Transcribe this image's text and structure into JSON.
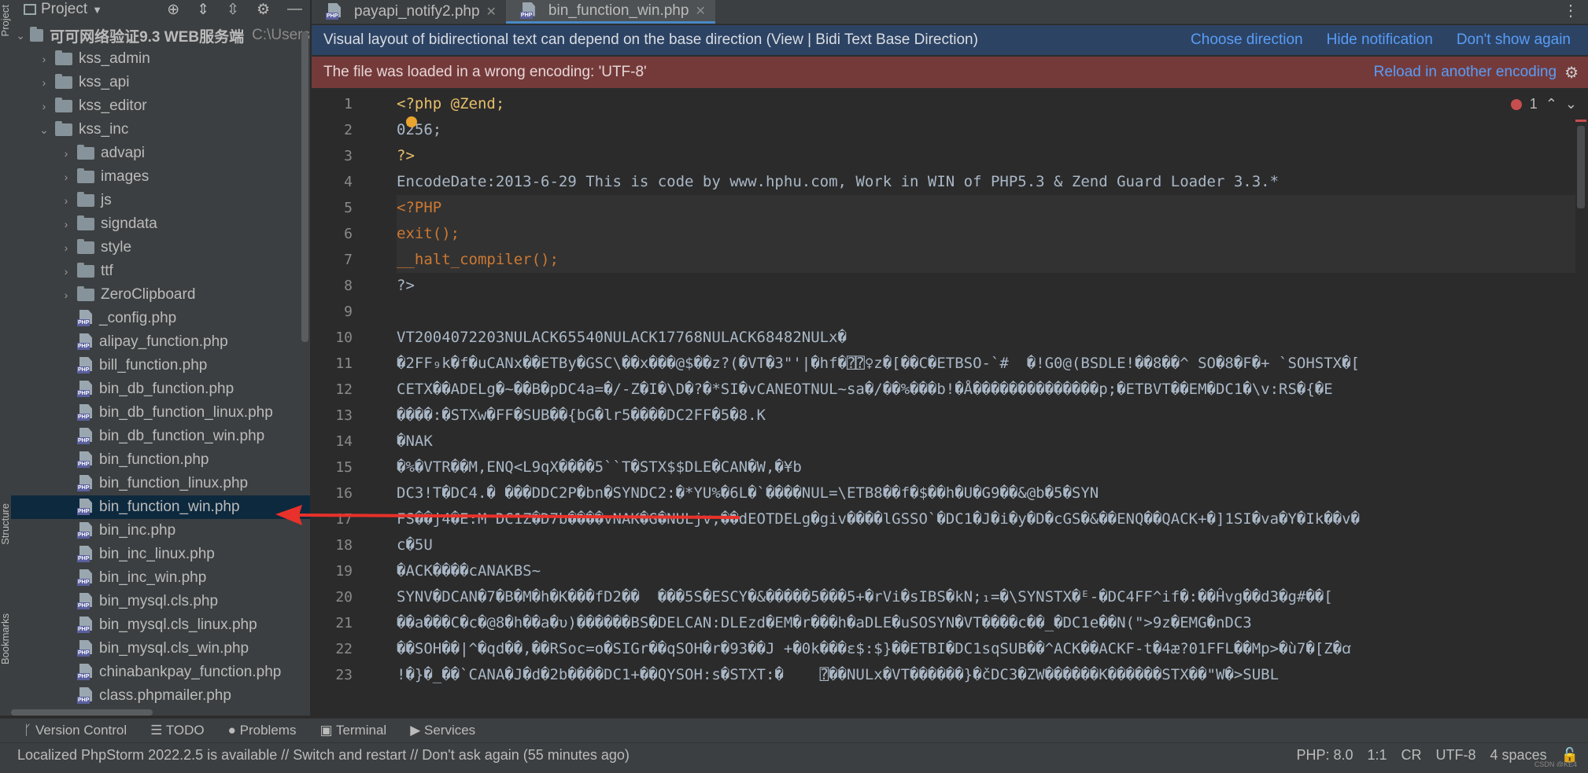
{
  "left_strip": {
    "tabs": [
      "Project",
      "Structure",
      "Bookmarks"
    ]
  },
  "project_panel": {
    "title": "Project",
    "root": {
      "name": "可可网络验证9.3 WEB服务端",
      "path": "C:\\Users"
    },
    "items": [
      {
        "label": "kss_admin",
        "type": "folder",
        "expanded": false,
        "indent": 1
      },
      {
        "label": "kss_api",
        "type": "folder",
        "expanded": false,
        "indent": 1
      },
      {
        "label": "kss_editor",
        "type": "folder",
        "expanded": false,
        "indent": 1
      },
      {
        "label": "kss_inc",
        "type": "folder",
        "expanded": true,
        "indent": 1
      },
      {
        "label": "advapi",
        "type": "folder",
        "expanded": false,
        "indent": 2
      },
      {
        "label": "images",
        "type": "folder",
        "expanded": false,
        "indent": 2
      },
      {
        "label": "js",
        "type": "folder",
        "expanded": false,
        "indent": 2
      },
      {
        "label": "signdata",
        "type": "folder",
        "expanded": false,
        "indent": 2
      },
      {
        "label": "style",
        "type": "folder",
        "expanded": false,
        "indent": 2
      },
      {
        "label": "ttf",
        "type": "folder",
        "expanded": false,
        "indent": 2
      },
      {
        "label": "ZeroClipboard",
        "type": "folder",
        "expanded": false,
        "indent": 2
      },
      {
        "label": "_config.php",
        "type": "php",
        "indent": 2
      },
      {
        "label": "alipay_function.php",
        "type": "php",
        "indent": 2
      },
      {
        "label": "bill_function.php",
        "type": "php",
        "indent": 2
      },
      {
        "label": "bin_db_function.php",
        "type": "php",
        "indent": 2
      },
      {
        "label": "bin_db_function_linux.php",
        "type": "php",
        "indent": 2
      },
      {
        "label": "bin_db_function_win.php",
        "type": "php",
        "indent": 2
      },
      {
        "label": "bin_function.php",
        "type": "php",
        "indent": 2
      },
      {
        "label": "bin_function_linux.php",
        "type": "php",
        "indent": 2
      },
      {
        "label": "bin_function_win.php",
        "type": "php",
        "indent": 2,
        "selected": true
      },
      {
        "label": "bin_inc.php",
        "type": "php",
        "indent": 2
      },
      {
        "label": "bin_inc_linux.php",
        "type": "php",
        "indent": 2
      },
      {
        "label": "bin_inc_win.php",
        "type": "php",
        "indent": 2
      },
      {
        "label": "bin_mysql.cls.php",
        "type": "php",
        "indent": 2
      },
      {
        "label": "bin_mysql.cls_linux.php",
        "type": "php",
        "indent": 2
      },
      {
        "label": "bin_mysql.cls_win.php",
        "type": "php",
        "indent": 2
      },
      {
        "label": "chinabankpay_function.php",
        "type": "php",
        "indent": 2
      },
      {
        "label": "class.phpmailer.php",
        "type": "php",
        "indent": 2
      }
    ]
  },
  "tabs": [
    {
      "label": "payapi_notify2.php",
      "active": false
    },
    {
      "label": "bin_function_win.php",
      "active": true
    }
  ],
  "bidi_notification": {
    "text": "Visual layout of bidirectional text can depend on the base direction (View | Bidi Text Base Direction)",
    "links": [
      "Choose direction",
      "Hide notification",
      "Don't show again"
    ]
  },
  "encoding_notification": {
    "text": "The file was loaded in a wrong encoding: 'UTF-8'",
    "link": "Reload in another encoding"
  },
  "inspection": {
    "errors": "1"
  },
  "code_lines": [
    {
      "n": "1",
      "text": "<?php @Zend;"
    },
    {
      "n": "2",
      "text": "0256;"
    },
    {
      "n": "3",
      "text": "?>"
    },
    {
      "n": "4",
      "text": "EncodeDate:2013-6-29 This is code by www.hphu.com, Work in WIN of PHP5.3 & Zend Guard Loader 3.3.*"
    },
    {
      "n": "5",
      "text": "<?PHP"
    },
    {
      "n": "6",
      "text": "exit();"
    },
    {
      "n": "7",
      "text": "__halt_compiler();"
    },
    {
      "n": "8",
      "text": "?>"
    },
    {
      "n": "9",
      "text": ""
    },
    {
      "n": "10",
      "text": "VT2004072203NULACK65540NULACK17768NULACK68482NULx�"
    },
    {
      "n": "11",
      "text": "�2FF₉k�f�uCANx��ETBy�GSC\\��x���@$��z?(�VT�3\"'|�hf�⍰⍰♀z�[��C�ETBSO-`#  �!G0@(BSDLE!��8��^ SO�8�F�+ `SOHSTX�["
    },
    {
      "n": "12",
      "text": "CETX��ADELg�~��B�pDC4a=�/-Z�I�\\D�?�*SI�vCANEOTNUL~sa�/��%���b!�Å��������������p;�ETBVT��EM�DC1�\\v:RS�{�E"
    },
    {
      "n": "13",
      "text": "����:�STXw�FF�SUB��{bG�lr5����DC2FF�5�8.K"
    },
    {
      "n": "14",
      "text": "�NAK"
    },
    {
      "n": "15",
      "text": "�%�VTR��M,ENQ<L9qX����5``T�STX$$DLE�CAN�W,�¥b"
    },
    {
      "n": "16",
      "text": "DC3!T�DC4.� ���DDC2P�bn�SYNDC2:�*YU%�6L�`����NUL=\\ETB8��f�$��h�U�G9��&@b�5�SYN"
    },
    {
      "n": "17",
      "text": "FS��j4�E:M DC1Z�D7b����vNAK�G�NULjv;��dEOTDELg�giv����lGSSO`�DC1�J�i�y�D�cGS�&��ENQ��QACK+�]1SI�va�Y�Ik��v�"
    },
    {
      "n": "18",
      "text": "c�5U"
    },
    {
      "n": "19",
      "text": "�ACK����cANAKBS~"
    },
    {
      "n": "20",
      "text": "SYNV�DCAN�7�B�M�h�K���fD2��  ���5S�ESCY�&�����5���5+�rVi�sIBS�kN;₁=�\\SYNSTX�ᴱ-�DC4FF^if�:��Ĥvg��d3�g#��["
    },
    {
      "n": "21",
      "text": "��a���C�c�@8�h��a�υ)������BS�DELCAN:DLEzd�EM�r���h�aDLE�uSOSYN�VT����c��_�DC1e��N(\">9z�EMG�nDC3"
    },
    {
      "n": "22",
      "text": "��SOH��|^�qd��,��RSoc=o�SIGr��qSOH�r�93��J +�0k���ε$:$}��ETBI�DC1sqSUB��^ACK��ACKF-t�4æ?01FFL��Mp>�ù7�[Z�ꭤ"
    },
    {
      "n": "23",
      "text": "!�}�_��`CANA�J�d�2b����DC1+��QYSOH:s�STXT:�    ⍰��NULx�VT������}�čDC3�ZW������K������STX��\"W�>SUBL"
    }
  ],
  "tool_windows": [
    "Version Control",
    "TODO",
    "Problems",
    "Terminal",
    "Services"
  ],
  "status": {
    "message": "Localized PhpStorm 2022.2.5 is available // Switch and restart // Don't ask again (55 minutes ago)",
    "php": "PHP: 8.0",
    "position": "1:1",
    "line_sep": "CR",
    "encoding": "UTF-8",
    "indent": "4 spaces"
  },
  "watermark": "CSDN @KE4",
  "colors": {
    "accent": "#4a88c7",
    "bidi_bg": "#2d4364",
    "enc_bg": "#743a3a",
    "arrow": "#e8312a"
  }
}
